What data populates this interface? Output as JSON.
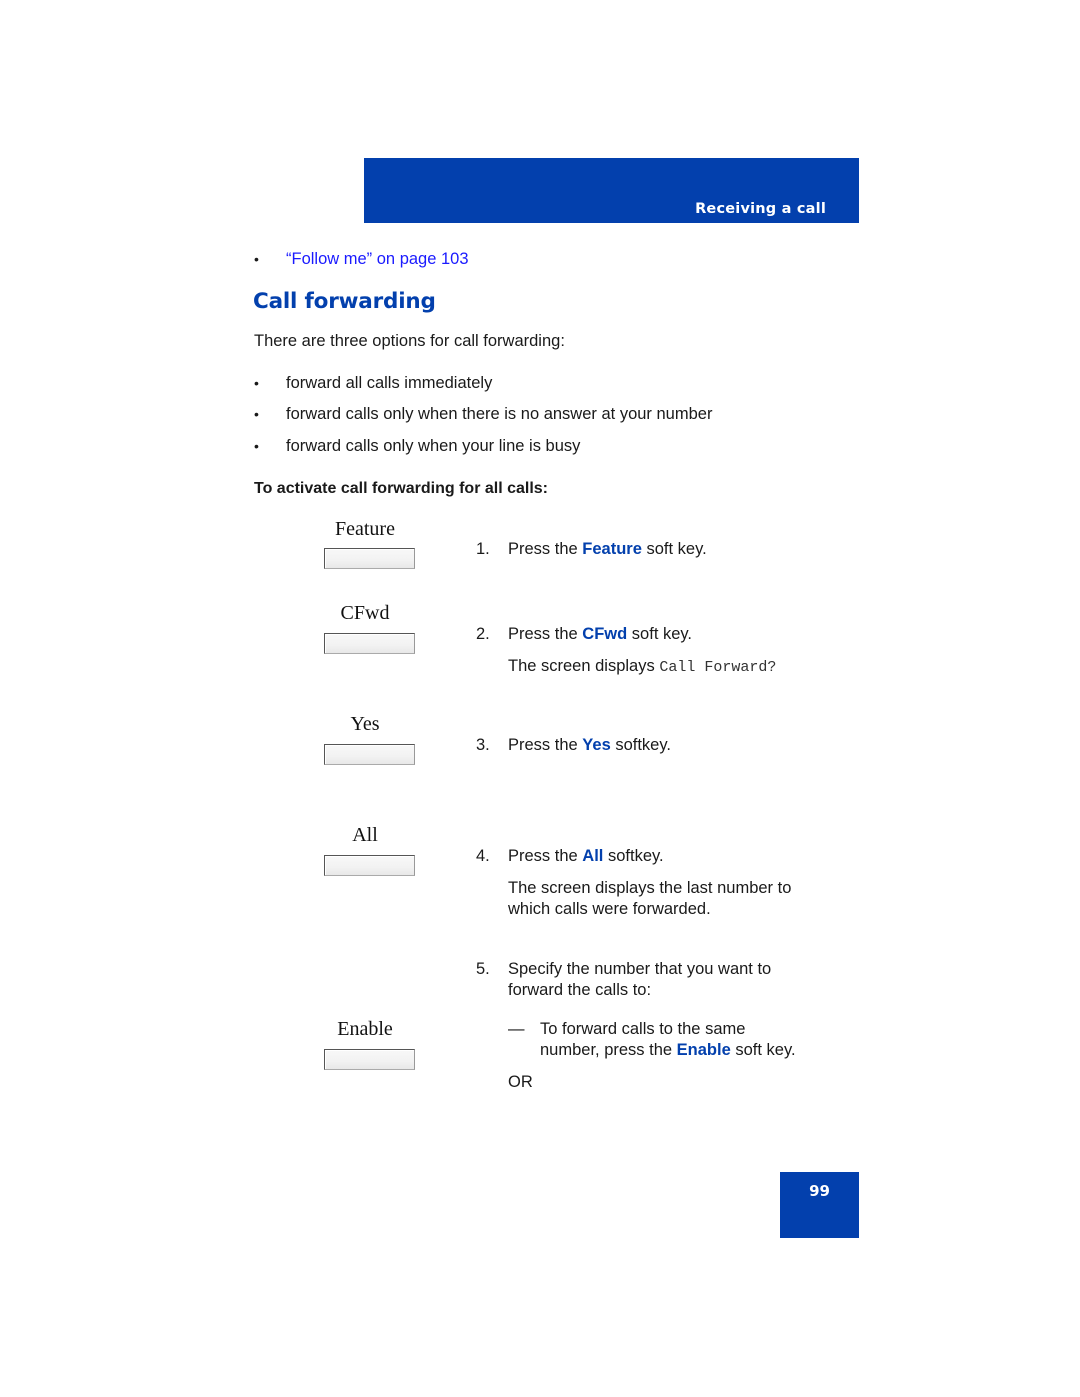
{
  "header": {
    "section_title": "Receiving a call",
    "band_color": "#0340ad"
  },
  "related_link": {
    "bullet": "•",
    "text": "“Follow me” on page 103"
  },
  "section": {
    "heading": "Call forwarding",
    "intro": "There are three options for call forwarding:",
    "options": [
      "forward all calls immediately",
      "forward calls only when there is no answer at your number",
      "forward calls only when your line is busy"
    ],
    "procedure_heading": "To activate call forwarding for all calls:"
  },
  "softkeys": [
    {
      "label": "Feature"
    },
    {
      "label": "CFwd"
    },
    {
      "label": "Yes"
    },
    {
      "label": "All"
    },
    {
      "label": "Enable"
    }
  ],
  "steps": [
    {
      "number": "1.",
      "prefix": "Press the ",
      "keyword": "Feature",
      "suffix": " soft key."
    },
    {
      "number": "2.",
      "prefix": "Press the ",
      "keyword": "CFwd",
      "suffix": " soft key.",
      "note_prefix": "The screen displays ",
      "note_display": "Call Forward?"
    },
    {
      "number": "3.",
      "prefix": "Press the ",
      "keyword": "Yes",
      "suffix": " softkey."
    },
    {
      "number": "4.",
      "prefix": "Press the ",
      "keyword": "All",
      "suffix": " softkey.",
      "note_line1": "The screen displays the last number to",
      "note_line2": "which calls were forwarded."
    },
    {
      "number": "5.",
      "line1": "Specify the number that you want to",
      "line2": "forward the calls to:",
      "sub_dash": "—",
      "sub_line1": "To forward calls to the same",
      "sub_line2_prefix": "number, press the ",
      "sub_keyword": "Enable",
      "sub_line2_suffix": " soft key.",
      "or_text": "OR"
    }
  ],
  "footer": {
    "page_number": "99"
  }
}
